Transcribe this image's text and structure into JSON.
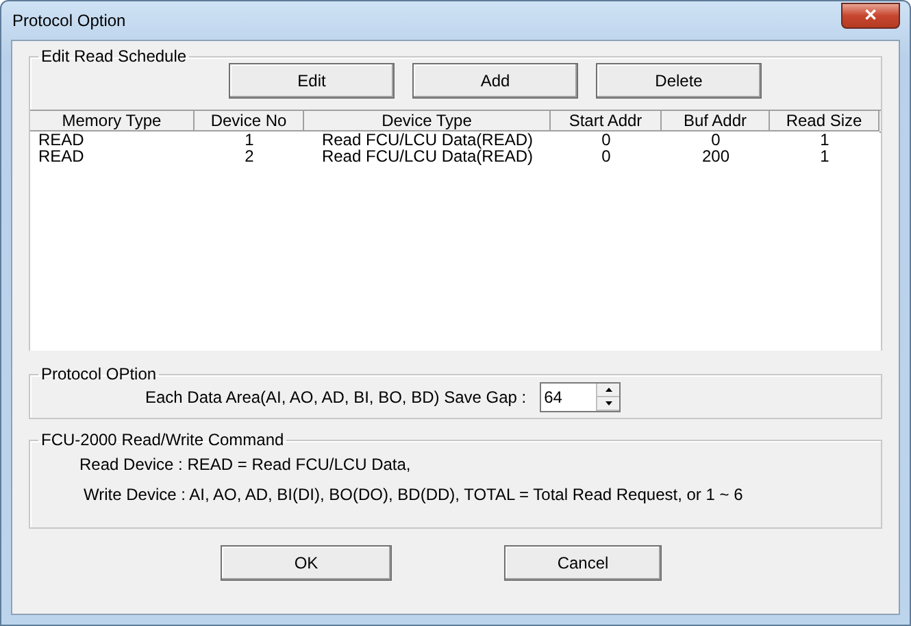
{
  "window": {
    "title": "Protocol Option",
    "close": "✕"
  },
  "schedule": {
    "legend": "Edit Read Schedule",
    "buttons": [
      "Edit",
      "Add",
      "Delete"
    ],
    "columns": [
      "Memory Type",
      "Device No",
      "Device Type",
      "Start Addr",
      "Buf Addr",
      "Read Size"
    ],
    "rows": [
      {
        "cells": [
          "READ",
          "1",
          "Read FCU/LCU Data(READ)",
          "0",
          "0",
          "1"
        ]
      },
      {
        "cells": [
          "READ",
          "2",
          "Read FCU/LCU Data(READ)",
          "0",
          "200",
          "1"
        ]
      }
    ]
  },
  "protocol": {
    "legend": "Protocol OPtion",
    "label": "Each Data Area(AI, AO, AD, BI, BO, BD) Save Gap :",
    "value": "64"
  },
  "command": {
    "legend": "FCU-2000 Read/Write Command",
    "lines": [
      "Read Device : READ = Read FCU/LCU Data,",
      "Write Device : AI, AO, AD, BI(DI), BO(DO), BD(DD), TOTAL = Total Read Request, or 1 ~ 6"
    ]
  },
  "footer": [
    "OK",
    "Cancel"
  ]
}
